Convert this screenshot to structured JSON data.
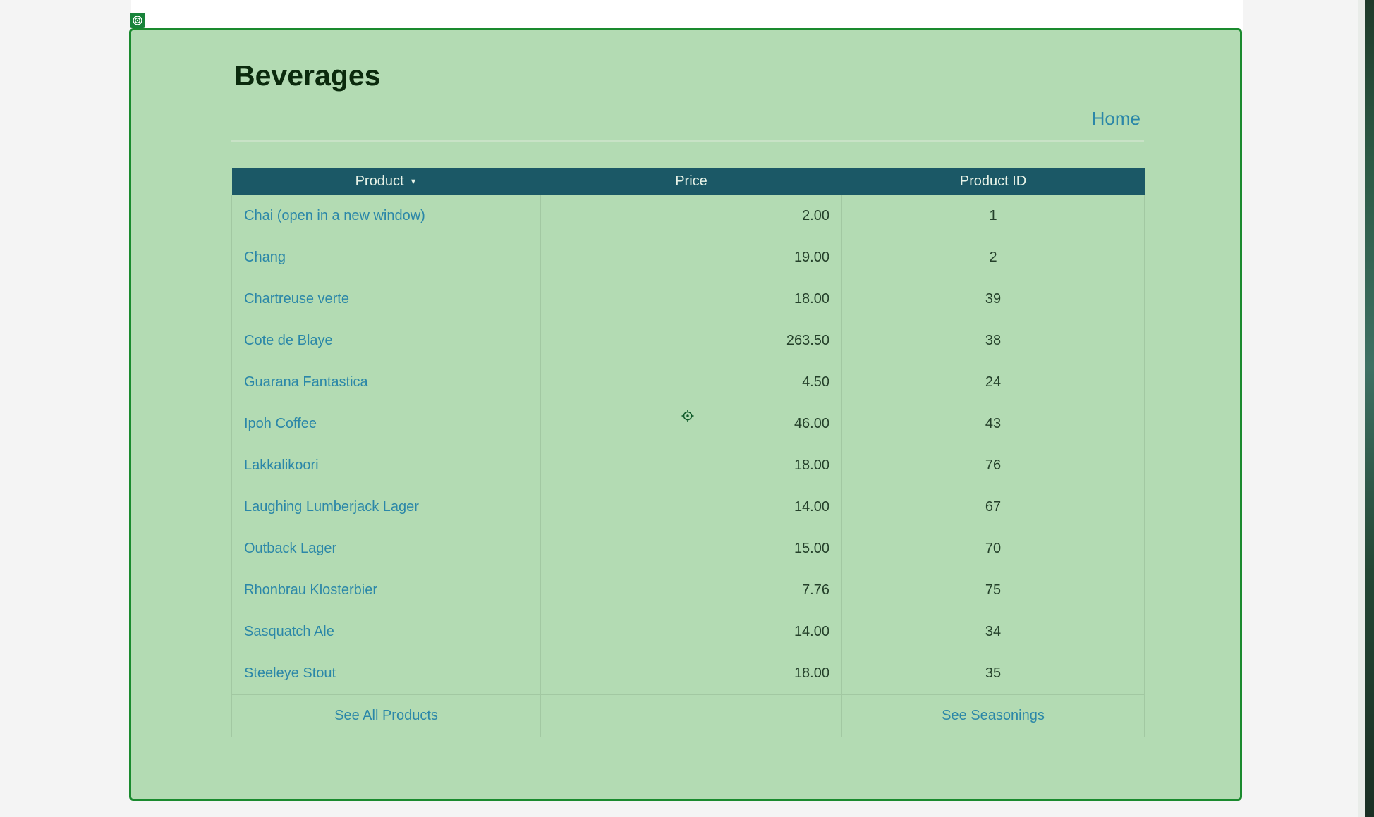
{
  "page": {
    "title": "Beverages",
    "home_link": "Home"
  },
  "table": {
    "headers": {
      "product": "Product",
      "price": "Price",
      "product_id": "Product ID"
    },
    "sort_indicator": "▼",
    "rows": [
      {
        "name": "Chai  (open in a new window)",
        "price": "2.00",
        "id": "1"
      },
      {
        "name": "Chang",
        "price": "19.00",
        "id": "2"
      },
      {
        "name": "Chartreuse verte",
        "price": "18.00",
        "id": "39"
      },
      {
        "name": "Cote de Blaye",
        "price": "263.50",
        "id": "38"
      },
      {
        "name": "Guarana Fantastica",
        "price": "4.50",
        "id": "24"
      },
      {
        "name": "Ipoh Coffee",
        "price": "46.00",
        "id": "43"
      },
      {
        "name": "Lakkalikoori",
        "price": "18.00",
        "id": "76"
      },
      {
        "name": "Laughing Lumberjack Lager",
        "price": "14.00",
        "id": "67"
      },
      {
        "name": "Outback Lager",
        "price": "15.00",
        "id": "70"
      },
      {
        "name": "Rhonbrau Klosterbier",
        "price": "7.76",
        "id": "75"
      },
      {
        "name": "Sasquatch Ale",
        "price": "14.00",
        "id": "34"
      },
      {
        "name": "Steeleye Stout",
        "price": "18.00",
        "id": "35"
      }
    ],
    "footer": {
      "left_link": "See All Products",
      "right_link": "See Seasonings"
    }
  },
  "icons": {
    "badge": "target-icon",
    "cursor": "crosshair-icon"
  },
  "colors": {
    "panel_bg": "#b3dbb3",
    "panel_border": "#1a8a2e",
    "header_bg": "#1b5866",
    "link": "#2b87a8",
    "title": "#0b2a0d"
  }
}
